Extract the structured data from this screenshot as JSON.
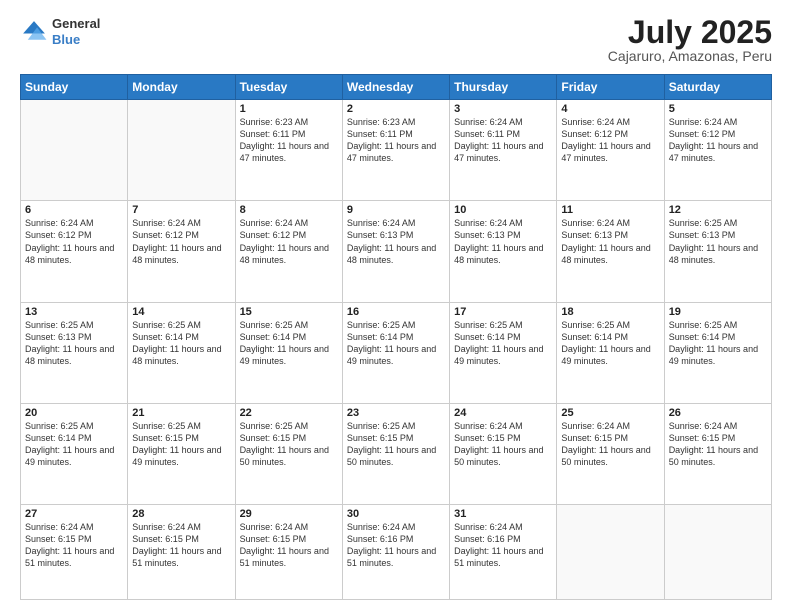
{
  "logo": {
    "line1": "General",
    "line2": "Blue"
  },
  "title": "July 2025",
  "subtitle": "Cajaruro, Amazonas, Peru",
  "weekdays": [
    "Sunday",
    "Monday",
    "Tuesday",
    "Wednesday",
    "Thursday",
    "Friday",
    "Saturday"
  ],
  "weeks": [
    [
      {
        "day": "",
        "sunrise": "",
        "sunset": "",
        "daylight": ""
      },
      {
        "day": "",
        "sunrise": "",
        "sunset": "",
        "daylight": ""
      },
      {
        "day": "1",
        "sunrise": "Sunrise: 6:23 AM",
        "sunset": "Sunset: 6:11 PM",
        "daylight": "Daylight: 11 hours and 47 minutes."
      },
      {
        "day": "2",
        "sunrise": "Sunrise: 6:23 AM",
        "sunset": "Sunset: 6:11 PM",
        "daylight": "Daylight: 11 hours and 47 minutes."
      },
      {
        "day": "3",
        "sunrise": "Sunrise: 6:24 AM",
        "sunset": "Sunset: 6:11 PM",
        "daylight": "Daylight: 11 hours and 47 minutes."
      },
      {
        "day": "4",
        "sunrise": "Sunrise: 6:24 AM",
        "sunset": "Sunset: 6:12 PM",
        "daylight": "Daylight: 11 hours and 47 minutes."
      },
      {
        "day": "5",
        "sunrise": "Sunrise: 6:24 AM",
        "sunset": "Sunset: 6:12 PM",
        "daylight": "Daylight: 11 hours and 47 minutes."
      }
    ],
    [
      {
        "day": "6",
        "sunrise": "Sunrise: 6:24 AM",
        "sunset": "Sunset: 6:12 PM",
        "daylight": "Daylight: 11 hours and 48 minutes."
      },
      {
        "day": "7",
        "sunrise": "Sunrise: 6:24 AM",
        "sunset": "Sunset: 6:12 PM",
        "daylight": "Daylight: 11 hours and 48 minutes."
      },
      {
        "day": "8",
        "sunrise": "Sunrise: 6:24 AM",
        "sunset": "Sunset: 6:12 PM",
        "daylight": "Daylight: 11 hours and 48 minutes."
      },
      {
        "day": "9",
        "sunrise": "Sunrise: 6:24 AM",
        "sunset": "Sunset: 6:13 PM",
        "daylight": "Daylight: 11 hours and 48 minutes."
      },
      {
        "day": "10",
        "sunrise": "Sunrise: 6:24 AM",
        "sunset": "Sunset: 6:13 PM",
        "daylight": "Daylight: 11 hours and 48 minutes."
      },
      {
        "day": "11",
        "sunrise": "Sunrise: 6:24 AM",
        "sunset": "Sunset: 6:13 PM",
        "daylight": "Daylight: 11 hours and 48 minutes."
      },
      {
        "day": "12",
        "sunrise": "Sunrise: 6:25 AM",
        "sunset": "Sunset: 6:13 PM",
        "daylight": "Daylight: 11 hours and 48 minutes."
      }
    ],
    [
      {
        "day": "13",
        "sunrise": "Sunrise: 6:25 AM",
        "sunset": "Sunset: 6:13 PM",
        "daylight": "Daylight: 11 hours and 48 minutes."
      },
      {
        "day": "14",
        "sunrise": "Sunrise: 6:25 AM",
        "sunset": "Sunset: 6:14 PM",
        "daylight": "Daylight: 11 hours and 48 minutes."
      },
      {
        "day": "15",
        "sunrise": "Sunrise: 6:25 AM",
        "sunset": "Sunset: 6:14 PM",
        "daylight": "Daylight: 11 hours and 49 minutes."
      },
      {
        "day": "16",
        "sunrise": "Sunrise: 6:25 AM",
        "sunset": "Sunset: 6:14 PM",
        "daylight": "Daylight: 11 hours and 49 minutes."
      },
      {
        "day": "17",
        "sunrise": "Sunrise: 6:25 AM",
        "sunset": "Sunset: 6:14 PM",
        "daylight": "Daylight: 11 hours and 49 minutes."
      },
      {
        "day": "18",
        "sunrise": "Sunrise: 6:25 AM",
        "sunset": "Sunset: 6:14 PM",
        "daylight": "Daylight: 11 hours and 49 minutes."
      },
      {
        "day": "19",
        "sunrise": "Sunrise: 6:25 AM",
        "sunset": "Sunset: 6:14 PM",
        "daylight": "Daylight: 11 hours and 49 minutes."
      }
    ],
    [
      {
        "day": "20",
        "sunrise": "Sunrise: 6:25 AM",
        "sunset": "Sunset: 6:14 PM",
        "daylight": "Daylight: 11 hours and 49 minutes."
      },
      {
        "day": "21",
        "sunrise": "Sunrise: 6:25 AM",
        "sunset": "Sunset: 6:15 PM",
        "daylight": "Daylight: 11 hours and 49 minutes."
      },
      {
        "day": "22",
        "sunrise": "Sunrise: 6:25 AM",
        "sunset": "Sunset: 6:15 PM",
        "daylight": "Daylight: 11 hours and 50 minutes."
      },
      {
        "day": "23",
        "sunrise": "Sunrise: 6:25 AM",
        "sunset": "Sunset: 6:15 PM",
        "daylight": "Daylight: 11 hours and 50 minutes."
      },
      {
        "day": "24",
        "sunrise": "Sunrise: 6:24 AM",
        "sunset": "Sunset: 6:15 PM",
        "daylight": "Daylight: 11 hours and 50 minutes."
      },
      {
        "day": "25",
        "sunrise": "Sunrise: 6:24 AM",
        "sunset": "Sunset: 6:15 PM",
        "daylight": "Daylight: 11 hours and 50 minutes."
      },
      {
        "day": "26",
        "sunrise": "Sunrise: 6:24 AM",
        "sunset": "Sunset: 6:15 PM",
        "daylight": "Daylight: 11 hours and 50 minutes."
      }
    ],
    [
      {
        "day": "27",
        "sunrise": "Sunrise: 6:24 AM",
        "sunset": "Sunset: 6:15 PM",
        "daylight": "Daylight: 11 hours and 51 minutes."
      },
      {
        "day": "28",
        "sunrise": "Sunrise: 6:24 AM",
        "sunset": "Sunset: 6:15 PM",
        "daylight": "Daylight: 11 hours and 51 minutes."
      },
      {
        "day": "29",
        "sunrise": "Sunrise: 6:24 AM",
        "sunset": "Sunset: 6:15 PM",
        "daylight": "Daylight: 11 hours and 51 minutes."
      },
      {
        "day": "30",
        "sunrise": "Sunrise: 6:24 AM",
        "sunset": "Sunset: 6:16 PM",
        "daylight": "Daylight: 11 hours and 51 minutes."
      },
      {
        "day": "31",
        "sunrise": "Sunrise: 6:24 AM",
        "sunset": "Sunset: 6:16 PM",
        "daylight": "Daylight: 11 hours and 51 minutes."
      },
      {
        "day": "",
        "sunrise": "",
        "sunset": "",
        "daylight": ""
      },
      {
        "day": "",
        "sunrise": "",
        "sunset": "",
        "daylight": ""
      }
    ]
  ]
}
